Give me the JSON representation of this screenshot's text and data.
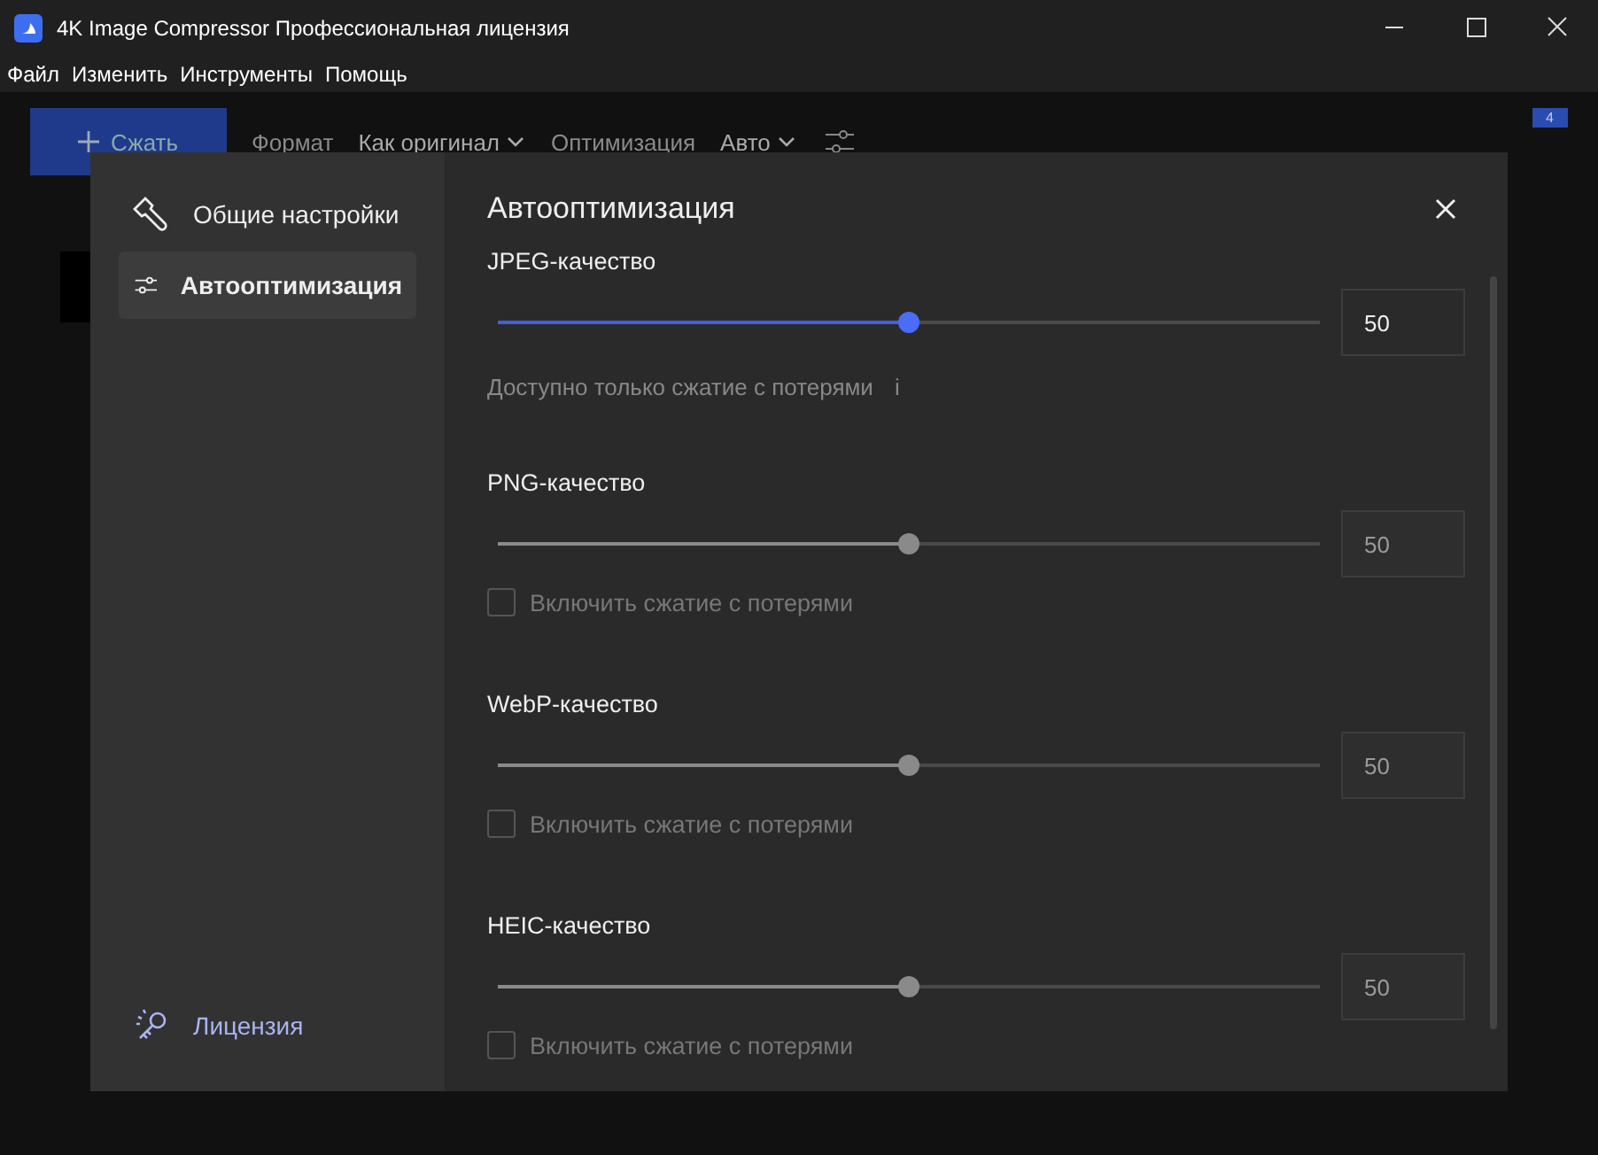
{
  "window": {
    "title": "4K Image Compressor Профессиональная лицензия"
  },
  "menu": [
    "Файл",
    "Изменить",
    "Инструменты",
    "Помощь"
  ],
  "toolbar": {
    "compress_button": "Сжать",
    "format_label": "Формат",
    "format_value": "Как оригинал",
    "optimization_label": "Оптимизация",
    "optimization_value": "Авто",
    "badge": "4"
  },
  "dialog": {
    "sidebar": {
      "items": [
        {
          "label": "Общие настройки",
          "kind": "wrench",
          "selected": false
        },
        {
          "label": "Автооптимизация",
          "kind": "sliders",
          "selected": true
        }
      ],
      "license": "Лицензия"
    },
    "title": "Автооптимизация",
    "sections": [
      {
        "label": "JPEG-качество",
        "level": 0.5,
        "value": "50",
        "disabled": false,
        "kind": "note",
        "note": "Доступно только сжатие с потерями",
        "info": "i"
      },
      {
        "label": "PNG-качество",
        "level": 0.5,
        "value": "50",
        "disabled": true,
        "kind": "checkbox",
        "checkbox_label": "Включить сжатие с потерями",
        "checked": false
      },
      {
        "label": "WebP-качество",
        "level": 0.5,
        "value": "50",
        "disabled": true,
        "kind": "checkbox",
        "checkbox_label": "Включить сжатие с потерями",
        "checked": false
      },
      {
        "label": "HEIC-качество",
        "level": 0.5,
        "value": "50",
        "disabled": true,
        "kind": "checkbox",
        "checkbox_label": "Включить сжатие с потерями",
        "checked": false
      }
    ]
  }
}
